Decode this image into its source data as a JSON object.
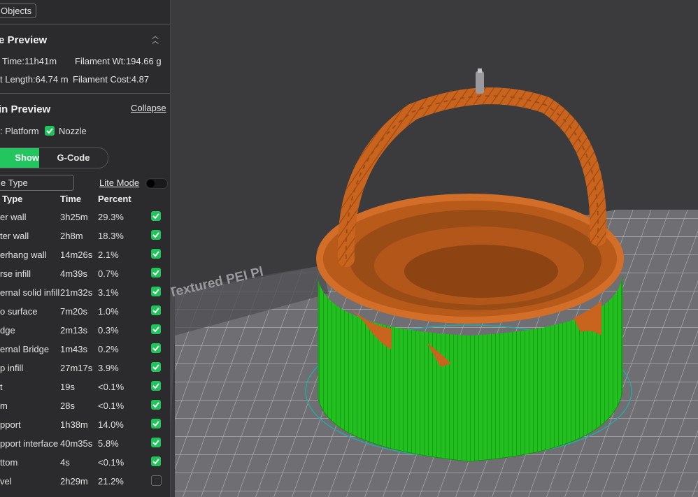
{
  "toolbar": {
    "objects_label": "Objects"
  },
  "slice_preview": {
    "title": "e Preview",
    "time": "Time:11h41m",
    "filament_wt": "Filament Wt:194.66 g",
    "length": "t Length:64.74 m",
    "cost": "Filament Cost:4.87"
  },
  "domain_preview": {
    "title": "in Preview",
    "collapse_label": "Collapse",
    "platform_label": ": Platform",
    "nozzle_label": "Nozzle",
    "nozzle_checked": true,
    "tabs": {
      "show": "Show",
      "gcode": "G-Code"
    },
    "dropdown_value": "e Type",
    "lite_mode_label": "Lite Mode",
    "lite_mode_on": false
  },
  "table": {
    "headers": {
      "type": "Type",
      "time": "Time",
      "percent": "Percent"
    },
    "rows": [
      {
        "type": "er wall",
        "time": "3h25m",
        "percent": "29.3%",
        "checked": true
      },
      {
        "type": "ter wall",
        "time": "2h8m",
        "percent": "18.3%",
        "checked": true
      },
      {
        "type": "erhang wall",
        "time": "14m26s",
        "percent": "2.1%",
        "checked": true
      },
      {
        "type": "rse infill",
        "time": "4m39s",
        "percent": "0.7%",
        "checked": true
      },
      {
        "type": "ernal solid infill",
        "time": "21m32s",
        "percent": "3.1%",
        "checked": true
      },
      {
        "type": "o surface",
        "time": "7m20s",
        "percent": "1.0%",
        "checked": true
      },
      {
        "type": "dge",
        "time": "2m13s",
        "percent": "0.3%",
        "checked": true
      },
      {
        "type": "ernal Bridge",
        "time": "1m43s",
        "percent": "0.2%",
        "checked": true
      },
      {
        "type": "p infill",
        "time": "27m17s",
        "percent": "3.9%",
        "checked": true
      },
      {
        "type": "t",
        "time": "19s",
        "percent": "<0.1%",
        "checked": true
      },
      {
        "type": "m",
        "time": "28s",
        "percent": "<0.1%",
        "checked": true
      },
      {
        "type": "pport",
        "time": "1h38m",
        "percent": "14.0%",
        "checked": true
      },
      {
        "type": "pport interface",
        "time": "40m35s",
        "percent": "5.8%",
        "checked": true
      },
      {
        "type": "ttom",
        "time": "4s",
        "percent": "<0.1%",
        "checked": true
      },
      {
        "type": "vel",
        "time": "2h29m",
        "percent": "21.2%",
        "checked": false
      }
    ]
  },
  "viewport": {
    "bed_label": "Creality Textured PEI Pl",
    "colors": {
      "support": "#22c01e",
      "wall": "#c8641e",
      "accent": "#22c55e",
      "bed": "#6f6f73"
    }
  }
}
